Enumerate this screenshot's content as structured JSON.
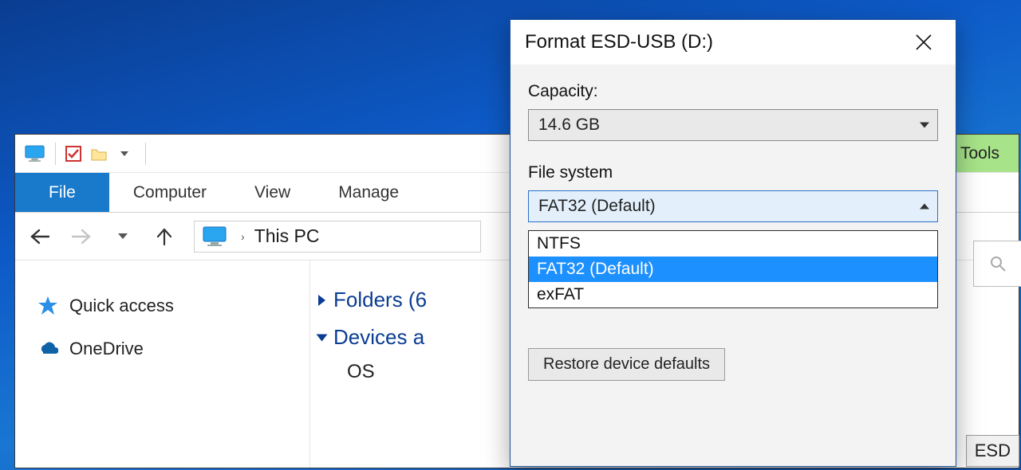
{
  "explorer": {
    "drive_tools_label": "Drive Tools",
    "ribbon": {
      "file": "File",
      "computer": "Computer",
      "view": "View",
      "manage": "Manage"
    },
    "breadcrumb": "This PC",
    "sidebar": {
      "quick_access": "Quick access",
      "onedrive": "OneDrive"
    },
    "groups": {
      "folders_label": "Folders (6",
      "devices_label": "Devices a",
      "os_fragment": "OS"
    }
  },
  "format_dialog": {
    "title": "Format ESD-USB (D:)",
    "capacity_label": "Capacity:",
    "capacity_value": "14.6 GB",
    "filesystem_label": "File system",
    "filesystem_selected": "FAT32 (Default)",
    "filesystem_options": {
      "ntfs": "NTFS",
      "fat32": "FAT32 (Default)",
      "exfat": "exFAT"
    },
    "restore_defaults": "Restore device defaults"
  },
  "fragments": {
    "esd": "ESD",
    "search_hint": ""
  }
}
